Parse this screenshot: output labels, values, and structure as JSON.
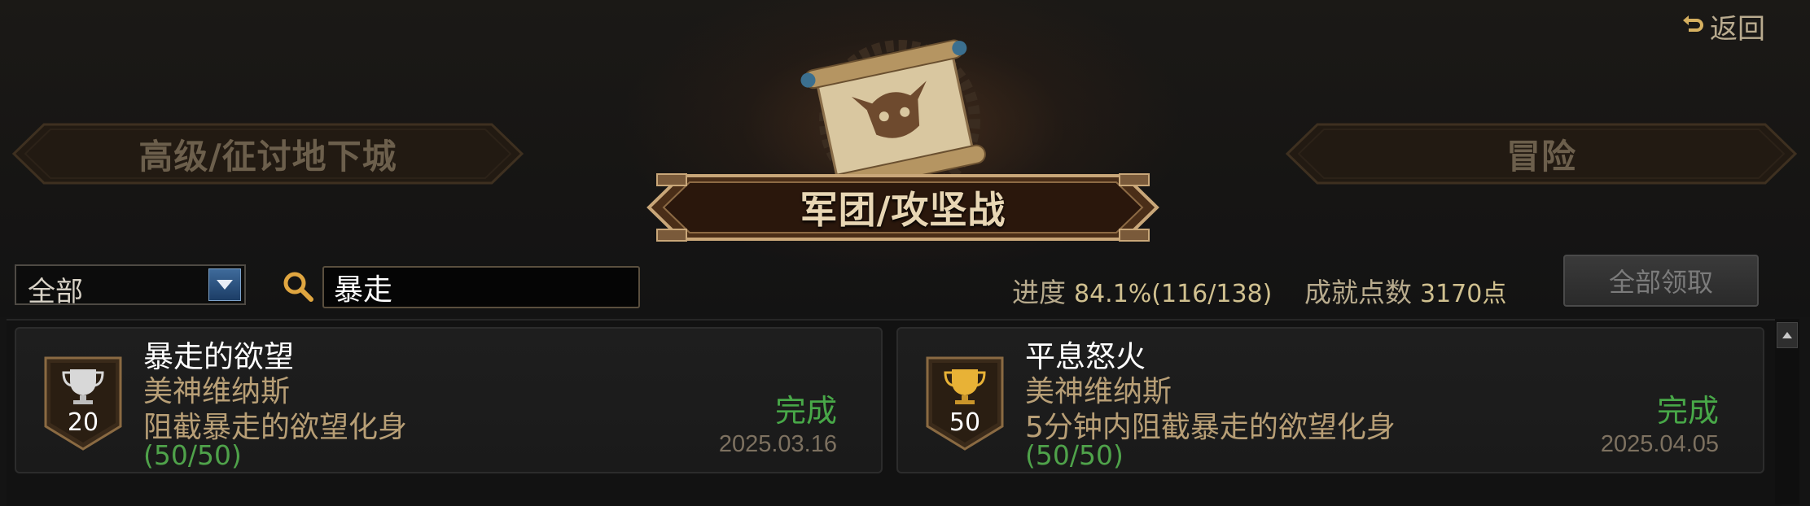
{
  "header": {
    "back_label": "返回"
  },
  "tabs": {
    "left_label": "高级/征讨地下城",
    "center_label": "军团/攻坚战",
    "right_label": "冒险"
  },
  "filters": {
    "category_selected": "全部",
    "search_value": "暴走"
  },
  "summary": {
    "progress_label": "进度",
    "progress_value": "84.1%(116/138)",
    "progress_fraction": 0.841,
    "points_label": "成就点数",
    "points_value": "3170点",
    "claim_all_label": "全部领取"
  },
  "achievements": [
    {
      "title": "暴走的欲望",
      "subtitle": "美神维纳斯",
      "description": "阻截暴走的欲望化身",
      "progress": "(50/50)",
      "points": "20",
      "status": "完成",
      "date": "2025.03.16",
      "trophy": "silver-trophy-icon"
    },
    {
      "title": "平息怒火",
      "subtitle": "美神维纳斯",
      "description": "5分钟内阻截暴走的欲望化身",
      "progress": "(50/50)",
      "points": "50",
      "status": "完成",
      "date": "2025.04.05",
      "trophy": "gold-trophy-icon"
    }
  ],
  "colors": {
    "complete_green": "#48a848",
    "gold_text": "#b89f76",
    "accent_blue": "#2c5283"
  }
}
